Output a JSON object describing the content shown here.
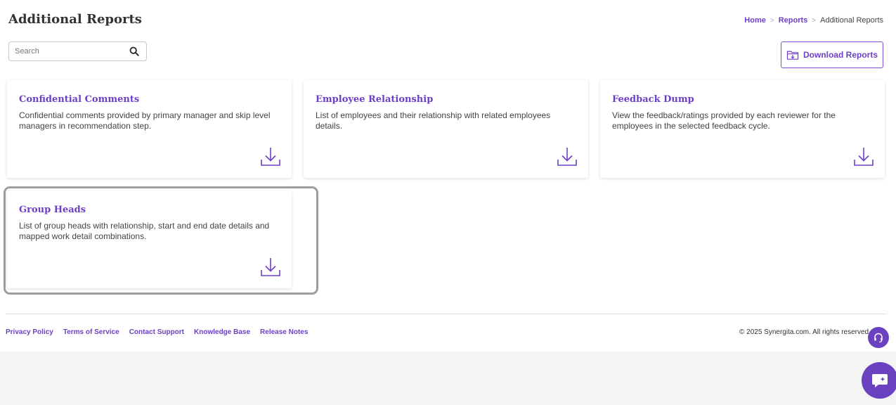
{
  "header": {
    "title": "Additional Reports",
    "breadcrumb": {
      "home": "Home",
      "reports": "Reports",
      "current": "Additional Reports",
      "separator": ">"
    }
  },
  "search": {
    "placeholder": "Search",
    "value": "",
    "icon": "search-icon"
  },
  "toolbar": {
    "download_label": "Download Reports",
    "download_icon": "folder-download-icon"
  },
  "cards": [
    {
      "title": "Confidential Comments",
      "description": "Confidential comments provided by primary manager and skip level managers in recommendation step.",
      "icon": "download-icon"
    },
    {
      "title": "Employee Relationship",
      "description": "List of employees and their relationship with related employees details.",
      "icon": "download-icon"
    },
    {
      "title": "Feedback Dump",
      "description": "View the feedback/ratings provided by each reviewer for the employees in the selected feedback cycle.",
      "icon": "download-icon"
    },
    {
      "title": "Group Heads",
      "description": "List of group heads with relationship, start and end date details and mapped work detail combinations.",
      "icon": "download-icon"
    }
  ],
  "footer": {
    "links": [
      "Privacy Policy",
      "Terms of Service",
      "Contact Support",
      "Knowledge Base",
      "Release Notes"
    ],
    "copyright": "© 2025 Synergita.com. All rights reserved."
  },
  "floating": {
    "support_icon": "headset-icon",
    "chat_icon": "chat-icon"
  },
  "colors": {
    "accent": "#6c3fc5",
    "floating_button": "#6a42c0",
    "footer_background": "#f4f4f4",
    "highlight_border": "#9e9e9e"
  }
}
